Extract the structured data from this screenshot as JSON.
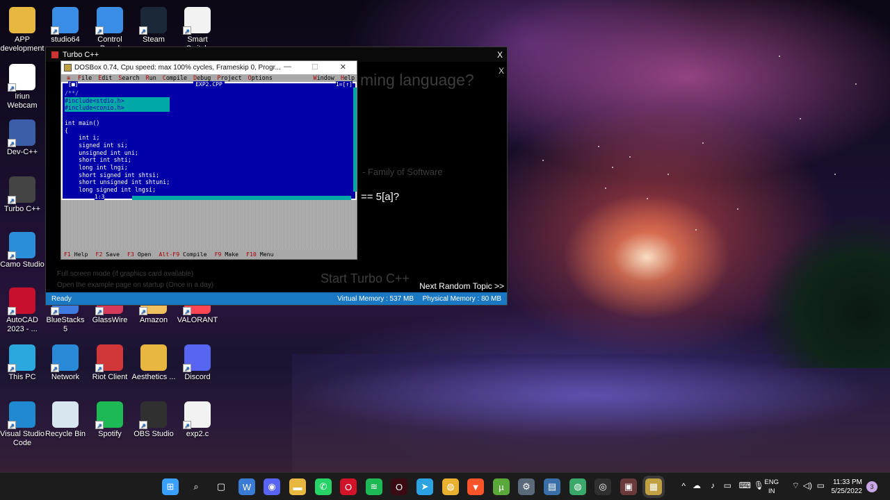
{
  "desktop_icons": [
    {
      "label": "APP development",
      "icon": "folder-icon",
      "color": "#e8b740"
    },
    {
      "label": "studio64",
      "icon": "android-studio-icon",
      "color": "#3a8ee6"
    },
    {
      "label": "Control Panel",
      "icon": "control-panel-icon",
      "color": "#3a8ee6"
    },
    {
      "label": "Steam",
      "icon": "steam-icon",
      "color": "#1b2838"
    },
    {
      "label": "Smart Switch",
      "icon": "file-icon",
      "color": "#f2f2f2"
    },
    {
      "label": "Iriun Webcam",
      "icon": "webcam-icon",
      "color": "#ffffff"
    },
    {
      "label": "Dev-C++",
      "icon": "dev-cpp-icon",
      "color": "#3b5ea8"
    },
    {
      "label": "Turbo C++",
      "icon": "turbo-cpp-icon",
      "color": "#444444"
    },
    {
      "label": "Camo Studio",
      "icon": "camo-icon",
      "color": "#2a8fd8"
    },
    {
      "label": "AutoCAD 2023 - ...",
      "icon": "autocad-icon",
      "color": "#c8102e"
    },
    {
      "label": "BlueStacks 5",
      "icon": "bluestacks-icon",
      "color": "#3d7be0"
    },
    {
      "label": "GlassWire",
      "icon": "glasswire-icon",
      "color": "#d63a5b"
    },
    {
      "label": "Amazon",
      "icon": "amazon-icon",
      "color": "#f0c060"
    },
    {
      "label": "VALORANT",
      "icon": "valorant-icon",
      "color": "#ff4655"
    },
    {
      "label": "This PC",
      "icon": "monitor-icon",
      "color": "#2ba8de"
    },
    {
      "label": "Network",
      "icon": "network-icon",
      "color": "#2a8ad8"
    },
    {
      "label": "Riot Client",
      "icon": "riot-icon",
      "color": "#d13639"
    },
    {
      "label": "Aesthetics ...",
      "icon": "folder-icon",
      "color": "#e8b740"
    },
    {
      "label": "Discord",
      "icon": "discord-icon",
      "color": "#5865f2"
    },
    {
      "label": "Visual Studio Code",
      "icon": "vscode-icon",
      "color": "#1f8ad2"
    },
    {
      "label": "Recycle Bin",
      "icon": "recycle-bin-icon",
      "color": "#d8e6f0"
    },
    {
      "label": "Spotify",
      "icon": "spotify-icon",
      "color": "#1db954"
    },
    {
      "label": "OBS Studio",
      "icon": "obs-icon",
      "color": "#303030"
    },
    {
      "label": "exp2.c",
      "icon": "file-icon",
      "color": "#f2f2f2"
    }
  ],
  "launcher": {
    "title": "Turbo C++",
    "close": "X",
    "close_inner": "X",
    "ghost_question": "ming language?",
    "ghost_family": "- Family of Software",
    "ghost_fullscreen": "Full screen mode (if graphics card available)",
    "ghost_open_example": "Open the example page on startup (Once in a day)",
    "ghost_start": "Start Turbo C++",
    "question_fragment": "== 5[a]?",
    "next_topic": "Next Random Topic >>",
    "status_ready": "Ready",
    "virtual_memory": "Virtual Memory : 537 MB",
    "physical_memory": "Physical Memory : 80 MB"
  },
  "dosbox": {
    "title": "DOSBox 0.74, Cpu speed: max 100% cycles, Frameskip  0, Progr...",
    "minimize": "—",
    "maximize": "☐",
    "close": "✕",
    "menu": [
      "File",
      "Edit",
      "Search",
      "Run",
      "Compile",
      "Debug",
      "Project",
      "Options"
    ],
    "menu_right": [
      "Window",
      "Help"
    ],
    "menu_system": "≡",
    "editor": {
      "filename": "EXP2.CPP",
      "left_marker": "[■]",
      "right_marker": "1=[↑]",
      "position": "1:3",
      "lines": [
        "/**/",
        "#include<stdio.h>",
        "#include<conio.h>",
        "",
        "int main()",
        "{",
        "    int i;",
        "    signed int si;",
        "    unsigned int uni;",
        "    short int shti;",
        "    long int lngi;",
        "    short signed int shtsi;",
        "    short unsigned int shtuni;",
        "    long signed int lngsi;"
      ]
    },
    "status": [
      {
        "key": "F1",
        "label": "Help"
      },
      {
        "key": "F2",
        "label": "Save"
      },
      {
        "key": "F3",
        "label": "Open"
      },
      {
        "key": "Alt-F9",
        "label": "Compile"
      },
      {
        "key": "F9",
        "label": "Make"
      },
      {
        "key": "F10",
        "label": "Menu"
      }
    ]
  },
  "taskbar": {
    "apps": [
      {
        "name": "start-icon",
        "glyph": "⊞",
        "color": "#3aa0ff"
      },
      {
        "name": "search-icon",
        "glyph": "⌕",
        "color": "#1c1c1c"
      },
      {
        "name": "task-view-icon",
        "glyph": "▢",
        "color": "#1c1c1c"
      },
      {
        "name": "widgets-icon",
        "glyph": "W",
        "color": "#3a7bd5"
      },
      {
        "name": "discord-taskbar-icon",
        "glyph": "◉",
        "color": "#5865f2"
      },
      {
        "name": "file-explorer-icon",
        "glyph": "▬",
        "color": "#e8b740"
      },
      {
        "name": "whatsapp-icon",
        "glyph": "✆",
        "color": "#25d366"
      },
      {
        "name": "opera-icon",
        "glyph": "O",
        "color": "#d1132a"
      },
      {
        "name": "spotify-taskbar-icon",
        "glyph": "≋",
        "color": "#1db954"
      },
      {
        "name": "opera-gx-icon",
        "glyph": "O",
        "color": "#3a0b12"
      },
      {
        "name": "telegram-icon",
        "glyph": "➤",
        "color": "#2aa3e0"
      },
      {
        "name": "chrome-icon",
        "glyph": "◍",
        "color": "#e8b230"
      },
      {
        "name": "brave-icon",
        "glyph": "▼",
        "color": "#fb542b"
      },
      {
        "name": "torrent-icon",
        "glyph": "µ",
        "color": "#5aa83a"
      },
      {
        "name": "settings-icon",
        "glyph": "⚙",
        "color": "#5a6a7a"
      },
      {
        "name": "task-manager-icon",
        "glyph": "▤",
        "color": "#3a6ea8"
      },
      {
        "name": "chrome-canary-icon",
        "glyph": "◍",
        "color": "#3aa86a"
      },
      {
        "name": "obs-taskbar-icon",
        "glyph": "◎",
        "color": "#303030"
      },
      {
        "name": "media-icon",
        "glyph": "▣",
        "color": "#6a3a3a"
      },
      {
        "name": "dosbox-taskbar-icon",
        "glyph": "▦",
        "color": "#c0a040"
      }
    ],
    "tray_chevron": "^",
    "language": "ENG",
    "region": "IN",
    "time": "11:33 PM",
    "date": "5/25/2022",
    "notifications": "3"
  }
}
